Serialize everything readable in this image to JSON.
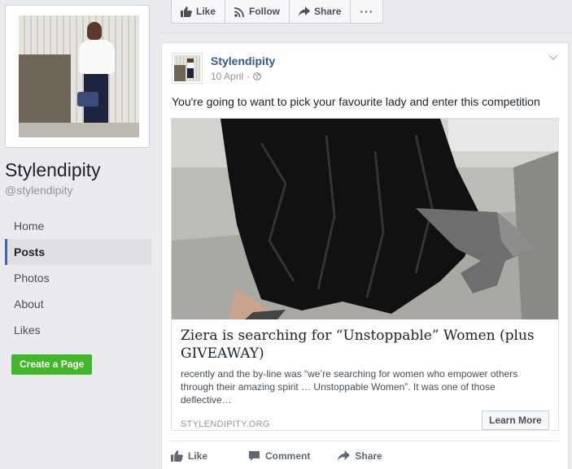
{
  "page": {
    "name": "Stylendipity",
    "handle": "@stylendipity"
  },
  "nav": {
    "items": [
      {
        "label": "Home",
        "active": false
      },
      {
        "label": "Posts",
        "active": true
      },
      {
        "label": "Photos",
        "active": false
      },
      {
        "label": "About",
        "active": false
      },
      {
        "label": "Likes",
        "active": false
      }
    ]
  },
  "create_page_label": "Create a Page",
  "actionbar": {
    "like_label": "Like",
    "follow_label": "Follow",
    "share_label": "Share",
    "more_label": "···"
  },
  "post": {
    "author": "Stylendipity",
    "date": "10 April",
    "date_separator": "·",
    "audience_icon": "globe-icon",
    "text": "You're going to want to pick your favourite lady and enter this competition",
    "link": {
      "title": "Ziera is searching for “Unstoppable” Women (plus GIVEAWAY)",
      "description": "recently and the by-line was “we’re searching for women who empower others through their amazing spirit … Unstoppable Women”. It was one of those deflective…",
      "domain": "STYLENDIPITY.ORG",
      "cta_label": "Learn More"
    },
    "actions": {
      "like_label": "Like",
      "comment_label": "Comment",
      "share_label": "Share"
    }
  },
  "colors": {
    "brand_link": "#365899",
    "active_nav_border": "#4267b2",
    "create_button": "#42b72a",
    "background": "#e9ebee"
  }
}
